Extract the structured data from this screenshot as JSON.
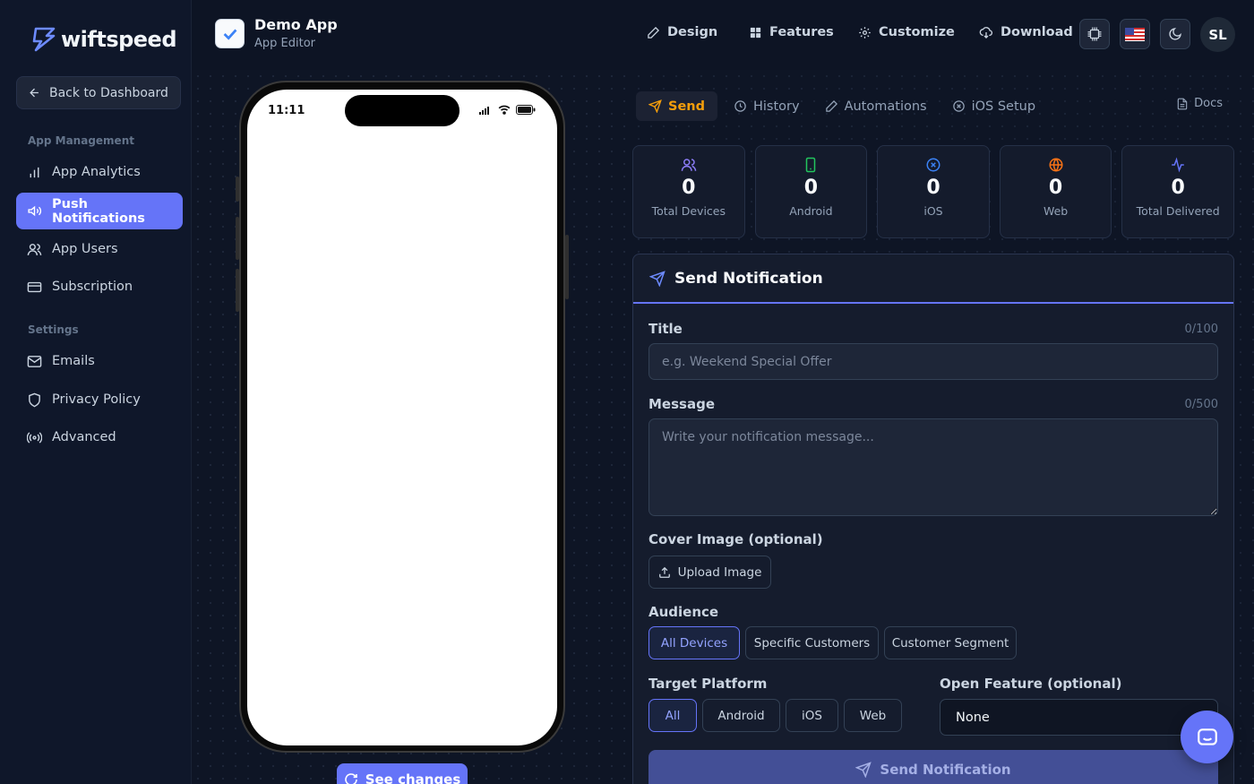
{
  "brand": {
    "logo_text": "wiftspeed"
  },
  "sidebar": {
    "back_label": "Back to Dashboard",
    "section_app": "App Management",
    "section_settings": "Settings",
    "items": [
      {
        "label": "App Analytics",
        "icon": "bar-chart-icon",
        "active": false
      },
      {
        "label": "Push Notifications",
        "icon": "megaphone-icon",
        "active": true
      },
      {
        "label": "App Users",
        "icon": "users-icon",
        "active": false
      },
      {
        "label": "Subscription",
        "icon": "credit-card-icon",
        "active": false
      },
      {
        "label": "Emails",
        "icon": "mail-icon",
        "active": false
      },
      {
        "label": "Privacy Policy",
        "icon": "shield-icon",
        "active": false
      },
      {
        "label": "Advanced",
        "icon": "radio-icon",
        "active": false
      }
    ]
  },
  "header": {
    "app_title": "Demo App",
    "app_subtitle": "App Editor",
    "nav": [
      "Design",
      "Features",
      "Customize",
      "Download"
    ],
    "avatar_initials": "SL"
  },
  "preview": {
    "status_time": "11:11",
    "see_changes_label": "See changes"
  },
  "tabs": {
    "items": [
      "Send",
      "History",
      "Automations",
      "iOS Setup"
    ],
    "active": "Send",
    "docs_label": "Docs"
  },
  "stats": [
    {
      "value": "0",
      "label": "Total Devices",
      "icon": "users-icon",
      "color": "#8b7cf6"
    },
    {
      "value": "0",
      "label": "Android",
      "icon": "smartphone-icon",
      "color": "#22c55e"
    },
    {
      "value": "0",
      "label": "iOS",
      "icon": "circle-x-icon",
      "color": "#3b82f6"
    },
    {
      "value": "0",
      "label": "Web",
      "icon": "globe-icon",
      "color": "#f97316"
    },
    {
      "value": "0",
      "label": "Total Delivered",
      "icon": "activity-icon",
      "color": "#6574f8"
    }
  ],
  "form": {
    "heading": "Send Notification",
    "title_label": "Title",
    "title_count": "0/100",
    "title_placeholder": "e.g. Weekend Special Offer",
    "message_label": "Message",
    "message_count": "0/500",
    "message_placeholder": "Write your notification message...",
    "cover_label": "Cover Image (optional)",
    "upload_label": "Upload Image",
    "audience_label": "Audience",
    "audience_options": [
      "All Devices",
      "Specific Customers",
      "Customer Segment"
    ],
    "audience_selected": "All Devices",
    "platform_label": "Target Platform",
    "platform_options": [
      "All",
      "Android",
      "iOS",
      "Web"
    ],
    "platform_selected": "All",
    "open_feature_label": "Open Feature (optional)",
    "open_feature_value": "None",
    "send_label": "Send Notification"
  },
  "colors": {
    "accent": "#6574f8",
    "tab_active": "#f59e0b"
  }
}
